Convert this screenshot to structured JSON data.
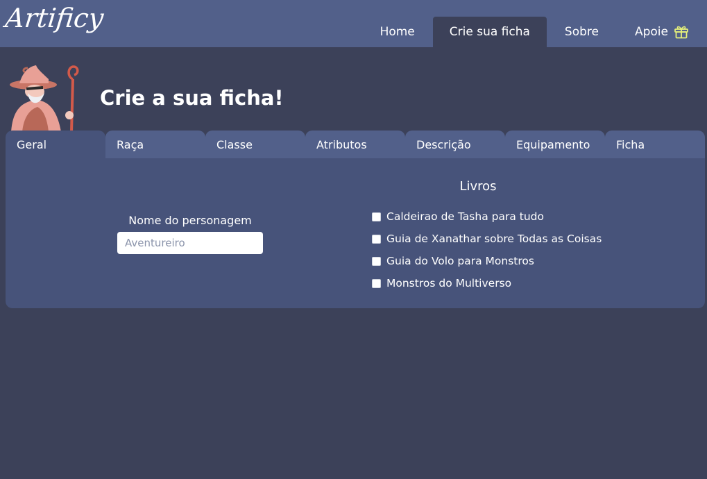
{
  "navbar": {
    "logo": "Artificy",
    "links": [
      {
        "label": "Home",
        "active": false
      },
      {
        "label": "Crie sua ficha",
        "active": true
      },
      {
        "label": "Sobre",
        "active": false
      },
      {
        "label": "Apoie",
        "active": false,
        "icon": "gift-icon"
      }
    ]
  },
  "hero": {
    "title": "Crie a sua ficha!",
    "image": "wizard-icon"
  },
  "tabs": [
    {
      "label": "Geral",
      "active": true
    },
    {
      "label": "Raça",
      "active": false
    },
    {
      "label": "Classe",
      "active": false
    },
    {
      "label": "Atributos",
      "active": false
    },
    {
      "label": "Descrição",
      "active": false
    },
    {
      "label": "Equipamento",
      "active": false
    },
    {
      "label": "Ficha",
      "active": false
    }
  ],
  "geral": {
    "name_label": "Nome do personagem",
    "name_value": "",
    "name_placeholder": "Aventureiro",
    "books_title": "Livros",
    "books": [
      {
        "label": "Caldeirao de Tasha para tudo",
        "checked": false
      },
      {
        "label": "Guia de Xanathar sobre Todas as Coisas",
        "checked": false
      },
      {
        "label": "Guia do Volo para Monstros",
        "checked": false
      },
      {
        "label": "Monstros do Multiverso",
        "checked": false
      }
    ]
  },
  "colors": {
    "navbar": "#52608a",
    "background": "#3c4159",
    "panel": "#47537a",
    "gift": "#e6f07a"
  }
}
